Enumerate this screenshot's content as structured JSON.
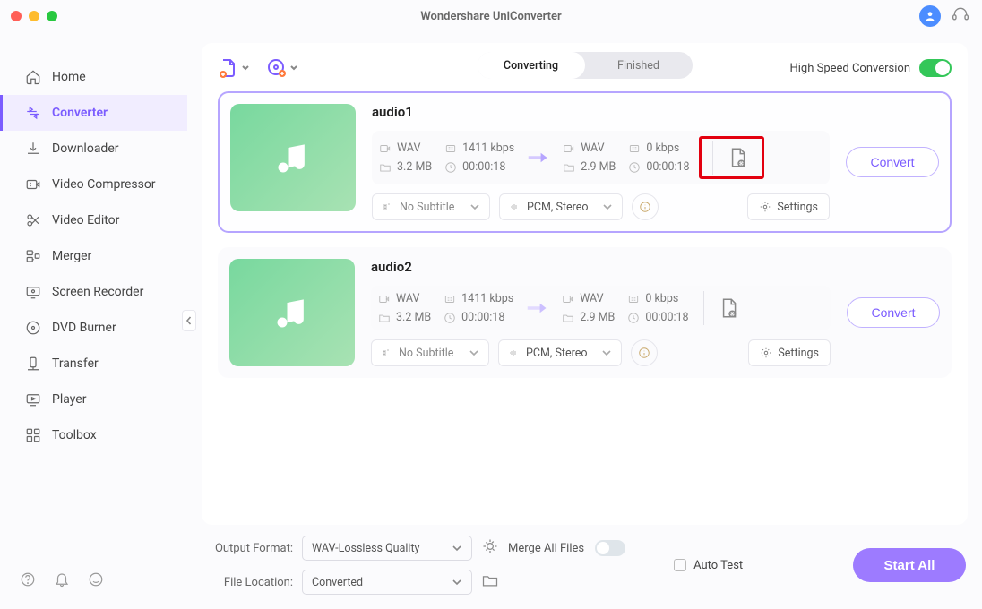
{
  "app": {
    "title": "Wondershare UniConverter"
  },
  "sidebar": {
    "items": [
      {
        "label": "Home",
        "icon": "home"
      },
      {
        "label": "Converter",
        "icon": "converter"
      },
      {
        "label": "Downloader",
        "icon": "downloader"
      },
      {
        "label": "Video Compressor",
        "icon": "compress"
      },
      {
        "label": "Video Editor",
        "icon": "editor"
      },
      {
        "label": "Merger",
        "icon": "merger"
      },
      {
        "label": "Screen Recorder",
        "icon": "record"
      },
      {
        "label": "DVD Burner",
        "icon": "dvd"
      },
      {
        "label": "Transfer",
        "icon": "transfer"
      },
      {
        "label": "Player",
        "icon": "player"
      },
      {
        "label": "Toolbox",
        "icon": "toolbox"
      }
    ]
  },
  "toolbar": {
    "tabs": {
      "converting": "Converting",
      "finished": "Finished"
    },
    "hsc_label": "High Speed Conversion",
    "hsc_on": true
  },
  "files": [
    {
      "name": "audio1",
      "src": {
        "format": "WAV",
        "bitrate": "1411 kbps",
        "size": "3.2 MB",
        "duration": "00:00:18"
      },
      "dst": {
        "format": "WAV",
        "bitrate": "0 kbps",
        "size": "2.9 MB",
        "duration": "00:00:18"
      },
      "subtitle": "No Subtitle",
      "codec": "PCM, Stereo",
      "settings_label": "Settings",
      "convert_label": "Convert",
      "highlight_page_icon": true
    },
    {
      "name": "audio2",
      "src": {
        "format": "WAV",
        "bitrate": "1411 kbps",
        "size": "3.2 MB",
        "duration": "00:00:18"
      },
      "dst": {
        "format": "WAV",
        "bitrate": "0 kbps",
        "size": "2.9 MB",
        "duration": "00:00:18"
      },
      "subtitle": "No Subtitle",
      "codec": "PCM, Stereo",
      "settings_label": "Settings",
      "convert_label": "Convert",
      "highlight_page_icon": false
    }
  ],
  "footer": {
    "output_format_label": "Output Format:",
    "output_format_value": "WAV-Lossless Quality",
    "file_location_label": "File Location:",
    "file_location_value": "Converted",
    "merge_label": "Merge All Files",
    "merge_on": false,
    "auto_test_label": "Auto Test",
    "start_all_label": "Start All"
  }
}
